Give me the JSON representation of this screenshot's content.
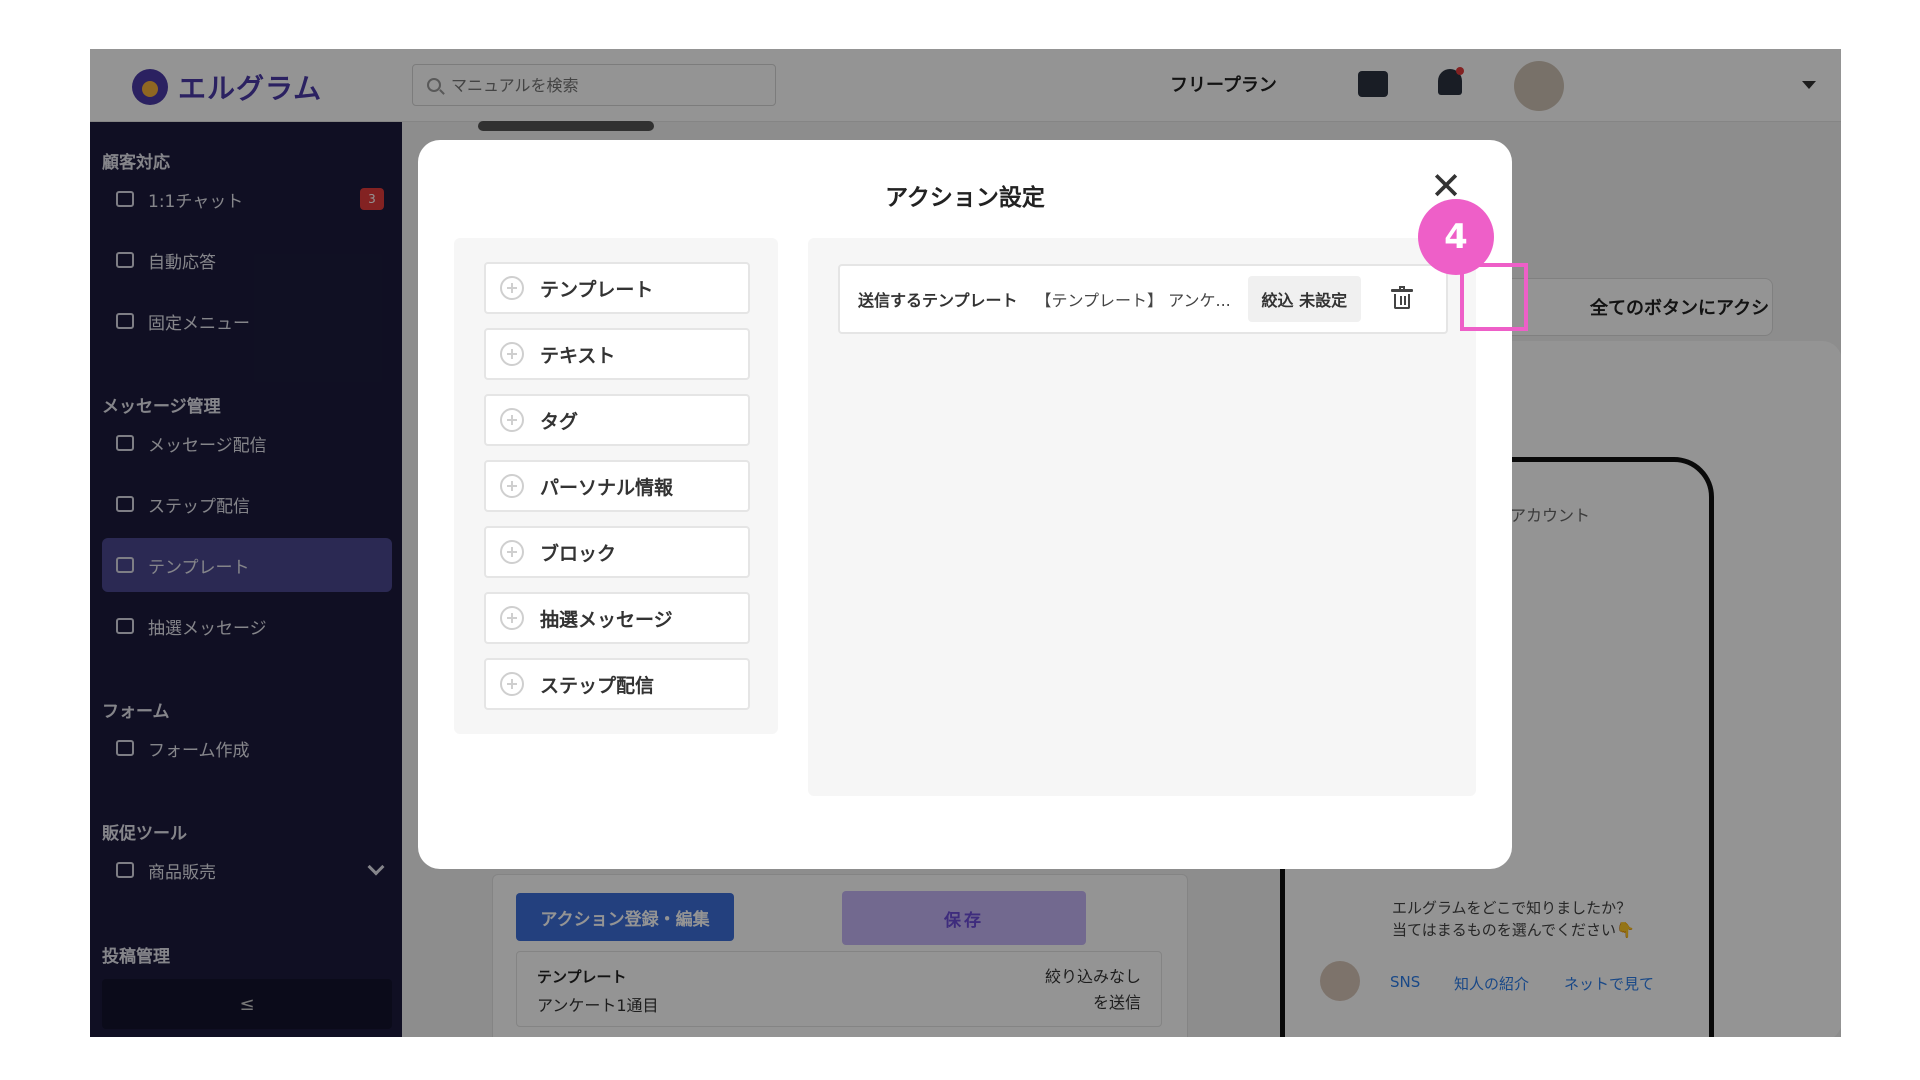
{
  "app": {
    "logo_text": "エルグラム",
    "search_placeholder": "マニュアルを検索",
    "plan_label": "フリープラン"
  },
  "sidebar": {
    "sections": [
      {
        "title": "顧客対応",
        "items": [
          {
            "label": "1:1チャット",
            "icon": "chat-icon",
            "badge": "3"
          },
          {
            "label": "自動応答",
            "icon": "reply-icon"
          },
          {
            "label": "固定メニュー",
            "icon": "menu-icon"
          }
        ]
      },
      {
        "title": "メッセージ管理",
        "items": [
          {
            "label": "メッセージ配信",
            "icon": "send-icon"
          },
          {
            "label": "ステップ配信",
            "icon": "step-icon"
          },
          {
            "label": "テンプレート",
            "icon": "template-icon",
            "active": true
          },
          {
            "label": "抽選メッセージ",
            "icon": "shuffle-icon"
          }
        ]
      },
      {
        "title": "フォーム",
        "items": [
          {
            "label": "フォーム作成",
            "icon": "form-icon"
          }
        ]
      },
      {
        "title": "販促ツール",
        "items": [
          {
            "label": "商品販売",
            "icon": "cart-icon"
          }
        ]
      },
      {
        "title": "投稿管理",
        "items": []
      }
    ],
    "collapse_label": "≤"
  },
  "background": {
    "add_action_label": "全てのボタンにアクション追加",
    "phone_account": "アカウント",
    "phone_message_line1": "エルグラムをどこで知りましたか？",
    "phone_message_line2": "当てはまるものを選んでください👇",
    "phone_options": [
      "SNS",
      "知人の紹介",
      "ネットで見て"
    ],
    "action_register_label": "アクション登録・編集",
    "save_label": "保存",
    "row_type": "テンプレート",
    "row_name": "アンケート1通目",
    "row_filter_line1": "絞り込みなし",
    "row_filter_line2": "を送信"
  },
  "modal": {
    "title": "アクション設定",
    "close_symbol": "✕",
    "action_buttons": [
      "テンプレート",
      "テキスト",
      "タグ",
      "パーソナル情報",
      "ブロック",
      "抽選メッセージ",
      "ステップ配信"
    ],
    "configured_action": {
      "label": "送信するテンプレート",
      "value": "【テンプレート】 アンケ...",
      "filter_label": "絞込 未設定"
    }
  },
  "annotation": {
    "step_number": "4",
    "color": "#ee5fc8"
  },
  "colors": {
    "sidebar_bg": "#1c1b3d",
    "brand": "#4a3aa8",
    "highlight": "#ee5fc8"
  }
}
